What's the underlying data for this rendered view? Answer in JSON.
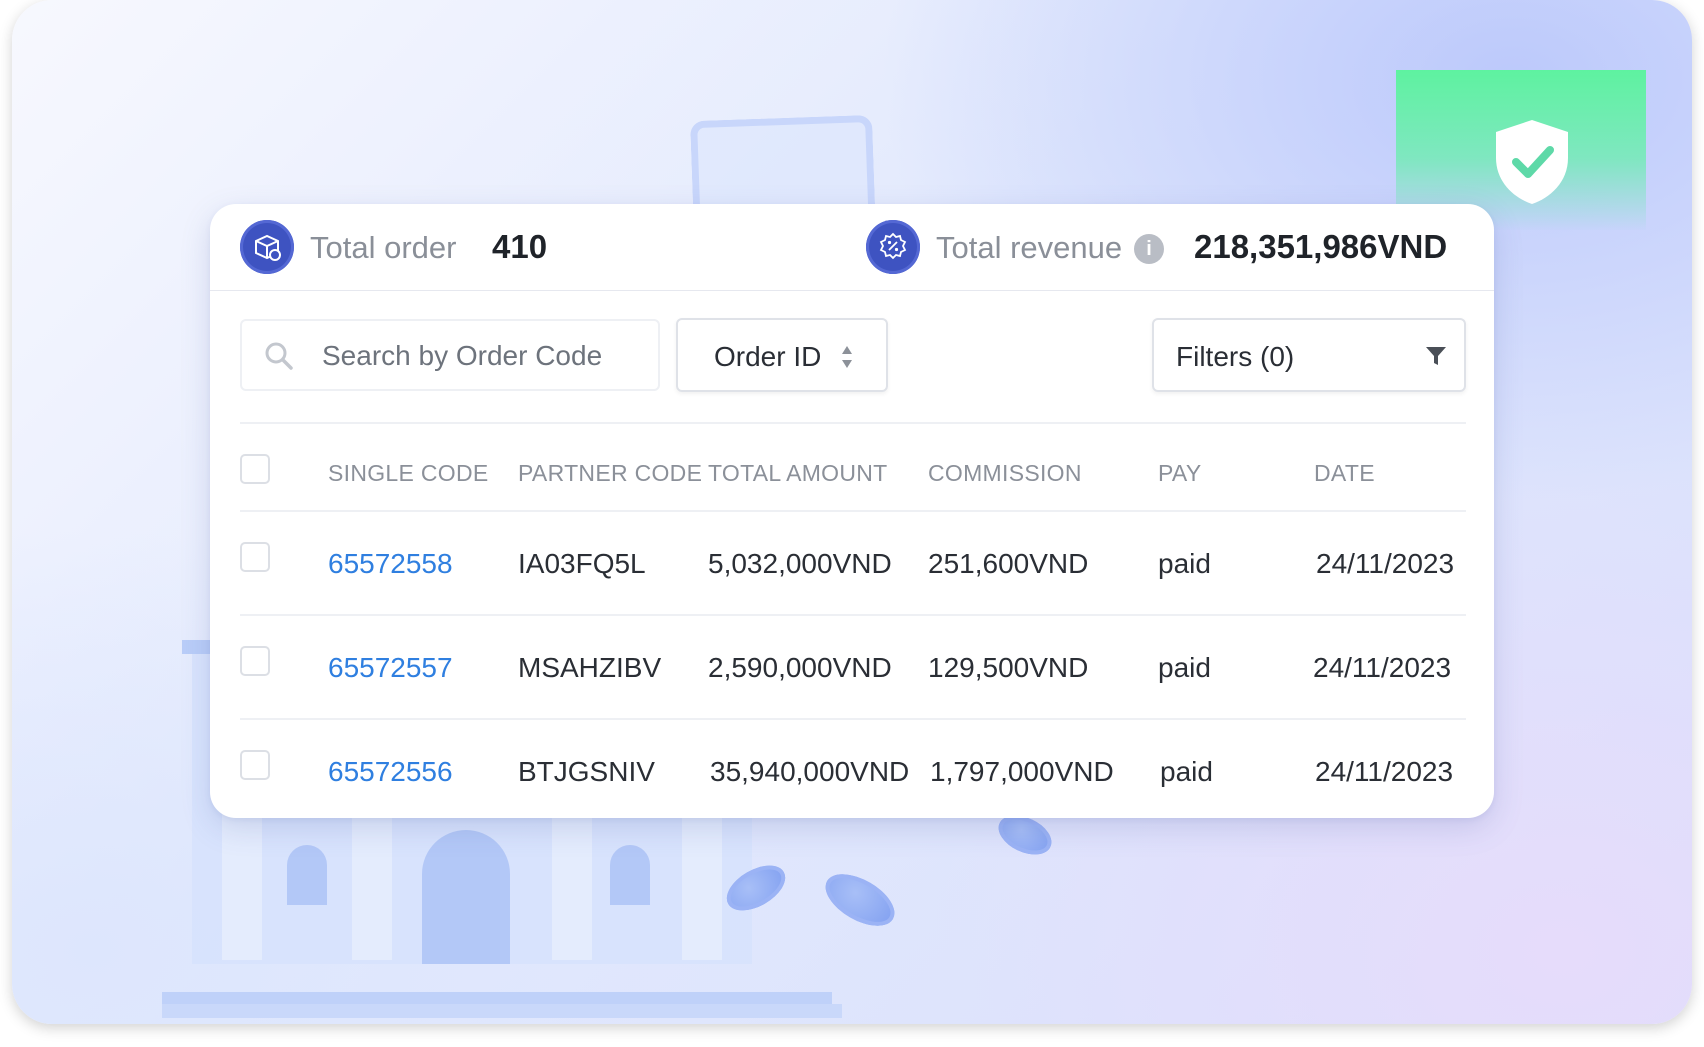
{
  "colors": {
    "accent": "#3e53c1",
    "link": "#2f7fe0",
    "shield_green": "#5ef2a0"
  },
  "stats": {
    "total_order": {
      "label": "Total order",
      "value": "410",
      "icon": "package-icon"
    },
    "total_revenue": {
      "label": "Total revenue",
      "value": "218,351,986VND",
      "icon": "percent-badge-icon",
      "info_icon": "info-icon"
    }
  },
  "toolbar": {
    "search_placeholder": "Search by Order Code",
    "sort_select": "Order ID",
    "filters_label": "Filters (0)"
  },
  "table": {
    "columns": [
      "SINGLE CODE",
      "PARTNER CODE",
      "TOTAL AMOUNT",
      "COMMISSION",
      "PAY",
      "DATE"
    ],
    "rows": [
      {
        "single_code": "65572558",
        "partner_code": "IA03FQ5L",
        "total_amount": "5,032,000VND",
        "commission": "251,600VND",
        "pay": "paid",
        "date": "24/11/2023"
      },
      {
        "single_code": "65572557",
        "partner_code": "MSAHZIBV",
        "total_amount": "2,590,000VND",
        "commission": "129,500VND",
        "pay": "paid",
        "date": "24/11/2023"
      },
      {
        "single_code": "65572556",
        "partner_code": "BTJGSNIV",
        "total_amount": "35,940,000VND",
        "commission": "1,797,000VND",
        "pay": "paid",
        "date": "24/11/2023"
      }
    ]
  }
}
